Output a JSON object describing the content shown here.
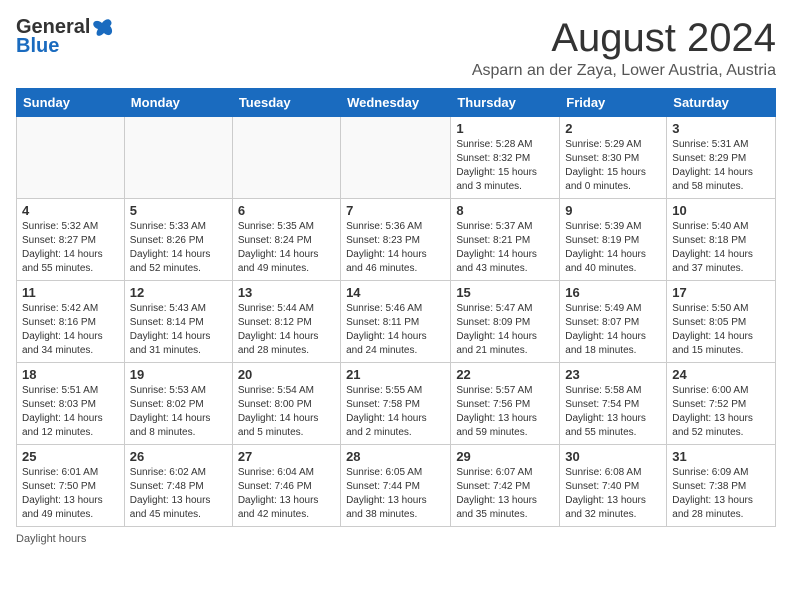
{
  "header": {
    "logo_general": "General",
    "logo_blue": "Blue",
    "month_title": "August 2024",
    "location": "Asparn an der Zaya, Lower Austria, Austria"
  },
  "days_of_week": [
    "Sunday",
    "Monday",
    "Tuesday",
    "Wednesday",
    "Thursday",
    "Friday",
    "Saturday"
  ],
  "weeks": [
    [
      {
        "day": "",
        "info": ""
      },
      {
        "day": "",
        "info": ""
      },
      {
        "day": "",
        "info": ""
      },
      {
        "day": "",
        "info": ""
      },
      {
        "day": "1",
        "info": "Sunrise: 5:28 AM\nSunset: 8:32 PM\nDaylight: 15 hours and 3 minutes."
      },
      {
        "day": "2",
        "info": "Sunrise: 5:29 AM\nSunset: 8:30 PM\nDaylight: 15 hours and 0 minutes."
      },
      {
        "day": "3",
        "info": "Sunrise: 5:31 AM\nSunset: 8:29 PM\nDaylight: 14 hours and 58 minutes."
      }
    ],
    [
      {
        "day": "4",
        "info": "Sunrise: 5:32 AM\nSunset: 8:27 PM\nDaylight: 14 hours and 55 minutes."
      },
      {
        "day": "5",
        "info": "Sunrise: 5:33 AM\nSunset: 8:26 PM\nDaylight: 14 hours and 52 minutes."
      },
      {
        "day": "6",
        "info": "Sunrise: 5:35 AM\nSunset: 8:24 PM\nDaylight: 14 hours and 49 minutes."
      },
      {
        "day": "7",
        "info": "Sunrise: 5:36 AM\nSunset: 8:23 PM\nDaylight: 14 hours and 46 minutes."
      },
      {
        "day": "8",
        "info": "Sunrise: 5:37 AM\nSunset: 8:21 PM\nDaylight: 14 hours and 43 minutes."
      },
      {
        "day": "9",
        "info": "Sunrise: 5:39 AM\nSunset: 8:19 PM\nDaylight: 14 hours and 40 minutes."
      },
      {
        "day": "10",
        "info": "Sunrise: 5:40 AM\nSunset: 8:18 PM\nDaylight: 14 hours and 37 minutes."
      }
    ],
    [
      {
        "day": "11",
        "info": "Sunrise: 5:42 AM\nSunset: 8:16 PM\nDaylight: 14 hours and 34 minutes."
      },
      {
        "day": "12",
        "info": "Sunrise: 5:43 AM\nSunset: 8:14 PM\nDaylight: 14 hours and 31 minutes."
      },
      {
        "day": "13",
        "info": "Sunrise: 5:44 AM\nSunset: 8:12 PM\nDaylight: 14 hours and 28 minutes."
      },
      {
        "day": "14",
        "info": "Sunrise: 5:46 AM\nSunset: 8:11 PM\nDaylight: 14 hours and 24 minutes."
      },
      {
        "day": "15",
        "info": "Sunrise: 5:47 AM\nSunset: 8:09 PM\nDaylight: 14 hours and 21 minutes."
      },
      {
        "day": "16",
        "info": "Sunrise: 5:49 AM\nSunset: 8:07 PM\nDaylight: 14 hours and 18 minutes."
      },
      {
        "day": "17",
        "info": "Sunrise: 5:50 AM\nSunset: 8:05 PM\nDaylight: 14 hours and 15 minutes."
      }
    ],
    [
      {
        "day": "18",
        "info": "Sunrise: 5:51 AM\nSunset: 8:03 PM\nDaylight: 14 hours and 12 minutes."
      },
      {
        "day": "19",
        "info": "Sunrise: 5:53 AM\nSunset: 8:02 PM\nDaylight: 14 hours and 8 minutes."
      },
      {
        "day": "20",
        "info": "Sunrise: 5:54 AM\nSunset: 8:00 PM\nDaylight: 14 hours and 5 minutes."
      },
      {
        "day": "21",
        "info": "Sunrise: 5:55 AM\nSunset: 7:58 PM\nDaylight: 14 hours and 2 minutes."
      },
      {
        "day": "22",
        "info": "Sunrise: 5:57 AM\nSunset: 7:56 PM\nDaylight: 13 hours and 59 minutes."
      },
      {
        "day": "23",
        "info": "Sunrise: 5:58 AM\nSunset: 7:54 PM\nDaylight: 13 hours and 55 minutes."
      },
      {
        "day": "24",
        "info": "Sunrise: 6:00 AM\nSunset: 7:52 PM\nDaylight: 13 hours and 52 minutes."
      }
    ],
    [
      {
        "day": "25",
        "info": "Sunrise: 6:01 AM\nSunset: 7:50 PM\nDaylight: 13 hours and 49 minutes."
      },
      {
        "day": "26",
        "info": "Sunrise: 6:02 AM\nSunset: 7:48 PM\nDaylight: 13 hours and 45 minutes."
      },
      {
        "day": "27",
        "info": "Sunrise: 6:04 AM\nSunset: 7:46 PM\nDaylight: 13 hours and 42 minutes."
      },
      {
        "day": "28",
        "info": "Sunrise: 6:05 AM\nSunset: 7:44 PM\nDaylight: 13 hours and 38 minutes."
      },
      {
        "day": "29",
        "info": "Sunrise: 6:07 AM\nSunset: 7:42 PM\nDaylight: 13 hours and 35 minutes."
      },
      {
        "day": "30",
        "info": "Sunrise: 6:08 AM\nSunset: 7:40 PM\nDaylight: 13 hours and 32 minutes."
      },
      {
        "day": "31",
        "info": "Sunrise: 6:09 AM\nSunset: 7:38 PM\nDaylight: 13 hours and 28 minutes."
      }
    ]
  ],
  "footer": {
    "note": "Daylight hours"
  }
}
